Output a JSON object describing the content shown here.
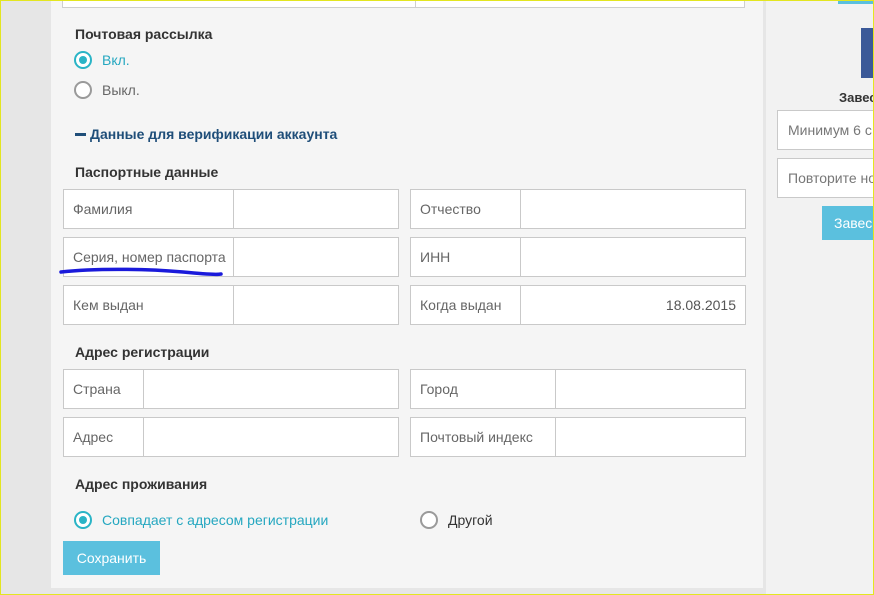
{
  "mailing": {
    "title": "Почтовая рассылка",
    "on_label": "Вкл.",
    "off_label": "Выкл."
  },
  "verification": {
    "toggle_label": "Данные для верификации аккаунта"
  },
  "passport": {
    "title": "Паспортные данные",
    "surname_label": "Фамилия",
    "patronymic_label": "Отчество",
    "passport_number_label": "Серия, номер паспорта",
    "inn_label": "ИНН",
    "issued_by_label": "Кем выдан",
    "issue_date_label": "Когда выдан",
    "issue_date_value": "18.08.2015"
  },
  "registration": {
    "title": "Адрес регистрации",
    "country_label": "Страна",
    "city_label": "Город",
    "address_label": "Адрес",
    "postal_label": "Почтовый индекс"
  },
  "residence": {
    "title": "Адрес проживания",
    "same_label": "Совпадает с адресом регистрации",
    "other_label": "Другой"
  },
  "save_label": "Сохранить",
  "sidebar": {
    "title": "Завес",
    "password_placeholder": "Минимум 6 с",
    "repeat_placeholder": "Повторите но",
    "button_label": "Завес"
  },
  "colors": {
    "accent": "#2ab4c6",
    "button": "#5bc0de",
    "link": "#1f4e79",
    "annotation": "#1a1adb"
  }
}
